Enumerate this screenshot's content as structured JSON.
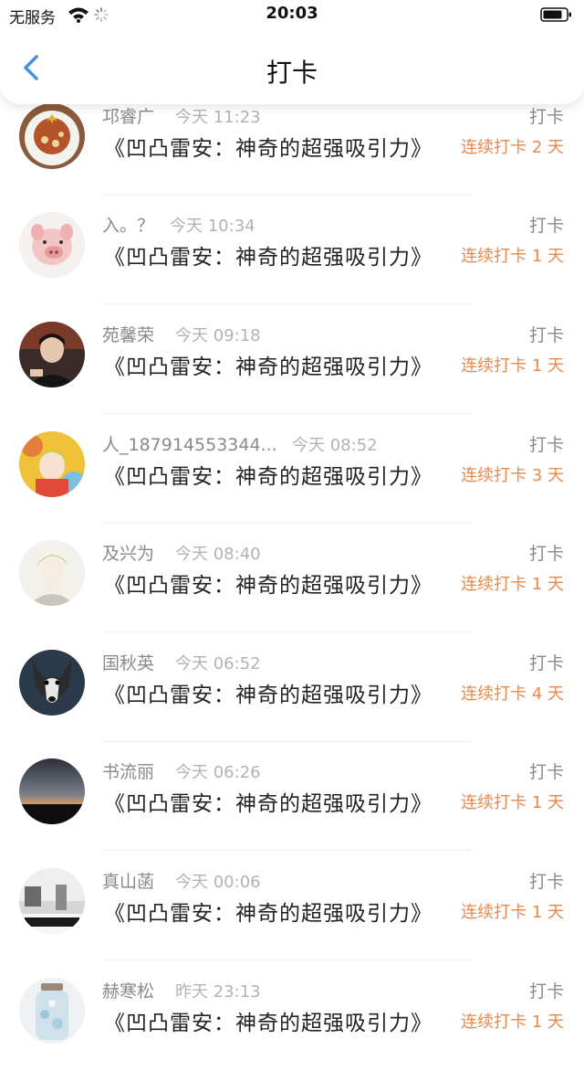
{
  "status_bar": {
    "carrier": "无服务",
    "time": "20:03"
  },
  "nav": {
    "title": "打卡"
  },
  "rows": [
    {
      "name": "邛睿广",
      "time": "今天 11:23",
      "book": "《凹凸雷安：神奇的超强吸引力》",
      "action": "打卡",
      "streak": "连续打卡 2 天",
      "avatar": "food-avatar"
    },
    {
      "name": "入。？",
      "time": "今天 10:34",
      "book": "《凹凸雷安：神奇的超强吸引力》",
      "action": "打卡",
      "streak": "连续打卡 1 天",
      "avatar": "pig-avatar"
    },
    {
      "name": "苑馨荣",
      "time": "今天 09:18",
      "book": "《凹凸雷安：神奇的超强吸引力》",
      "action": "打卡",
      "streak": "连续打卡 1 天",
      "avatar": "person-avatar"
    },
    {
      "name": "人_187914553344...",
      "time": "今天 08:52",
      "book": "《凹凸雷安：神奇的超强吸引力》",
      "action": "打卡",
      "streak": "连续打卡 3 天",
      "avatar": "anime-colorful-avatar"
    },
    {
      "name": "及兴为",
      "time": "今天 08:40",
      "book": "《凹凸雷安：神奇的超强吸引力》",
      "action": "打卡",
      "streak": "连续打卡 1 天",
      "avatar": "anime-sketch-avatar"
    },
    {
      "name": "国秋英",
      "time": "今天 06:52",
      "book": "《凹凸雷安：神奇的超强吸引力》",
      "action": "打卡",
      "streak": "连续打卡 4 天",
      "avatar": "dog-avatar"
    },
    {
      "name": "书流丽",
      "time": "今天 06:26",
      "book": "《凹凸雷安：神奇的超强吸引力》",
      "action": "打卡",
      "streak": "连续打卡 1 天",
      "avatar": "sunset-avatar"
    },
    {
      "name": "真山菡",
      "time": "今天 00:06",
      "book": "《凹凸雷安：神奇的超强吸引力》",
      "action": "打卡",
      "streak": "连续打卡 1 天",
      "avatar": "street-avatar"
    },
    {
      "name": "赫寒松",
      "time": "昨天 23:13",
      "book": "《凹凸雷安：神奇的超强吸引力》",
      "action": "打卡",
      "streak": "连续打卡 1 天",
      "avatar": "jar-avatar"
    }
  ],
  "colors": {
    "accent": "#4a90e2",
    "streak": "#e8894b",
    "name": "#8a8a8a",
    "time": "#b3b3b3"
  }
}
